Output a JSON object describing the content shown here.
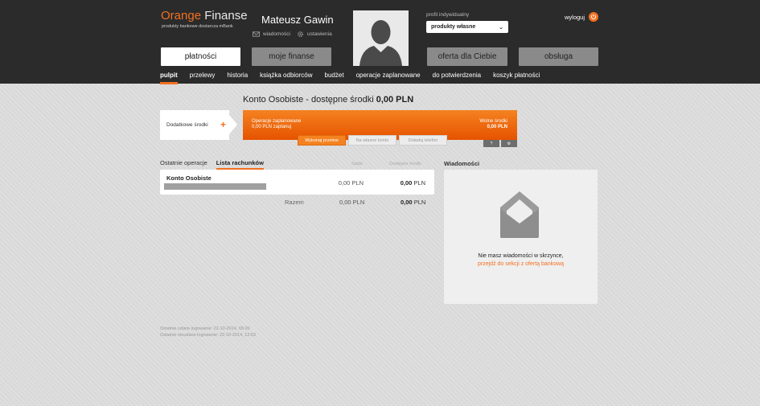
{
  "brand": {
    "orange": "Orange",
    "finanse": "Finanse",
    "tagline": "produkty bankowe dostarcza mBank"
  },
  "user": {
    "name": "Mateusz Gawin",
    "messages_link": "wiadomości",
    "settings_link": "ustawienia"
  },
  "profile": {
    "label": "profil indywidualny",
    "selected": "produkty własne"
  },
  "logout": {
    "label": "wyloguj"
  },
  "nav": {
    "payments": "płatności",
    "my_finance": "moje finanse",
    "offer": "oferta dla Ciebie",
    "service": "obsługa"
  },
  "subnav": [
    "pulpit",
    "przelewy",
    "historia",
    "książka odbiorców",
    "budżet",
    "operacje zaplanowane",
    "do potwierdzenia",
    "koszyk płatności"
  ],
  "account_header": {
    "prefix": "Konto Osobiste - dostępne środki",
    "amount": "0,00 PLN"
  },
  "extra_box": {
    "label": "Dodatkowe środki"
  },
  "planned": {
    "label": "Operacje zaplanowane",
    "amount": "0,00 PLN zaplanuj"
  },
  "free_funds": {
    "label": "Wolne środki",
    "amount": "0,00 PLN"
  },
  "actions": {
    "transfer": "Wykonaj przelew",
    "own_account": "Na własne konto",
    "top_up": "Doładuj telefon"
  },
  "small_buttons": {
    "help": "?",
    "settings": "⚙"
  },
  "tabs": {
    "recent": "Ostatnie operacje",
    "accounts": "Lista rachunków"
  },
  "columns": {
    "saldo": "Saldo",
    "available": "Dostępne środki"
  },
  "accounts": [
    {
      "name": "Konto Osobiste",
      "saldo": "0,00 PLN",
      "available": "0,00",
      "currency": "PLN"
    }
  ],
  "total": {
    "label": "Razem",
    "saldo": "0,00 PLN",
    "available": "0,00",
    "currency": "PLN"
  },
  "messages": {
    "title": "Wiadomości",
    "empty": "Nie masz wiadomości w skrzynce,",
    "link": "przejdź do sekcji z ofertą bankową"
  },
  "login_info": {
    "last_success": "Ostatnie udane logowanie: 22-10-2014, 09:20",
    "last_failed": "Ostatnie nieudane logowanie: 22-10-2014, 13:53"
  },
  "colors": {
    "accent": "#f37021",
    "header_bg": "#2b2b2b"
  }
}
